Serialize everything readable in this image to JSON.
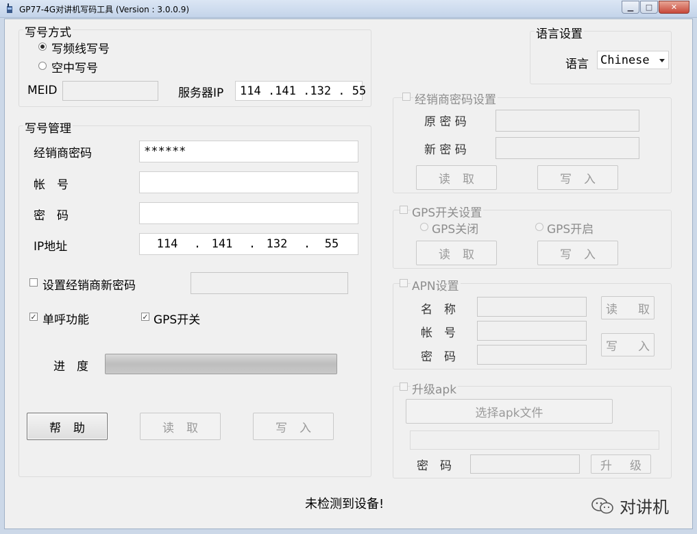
{
  "window": {
    "title": "GP77-4G对讲机写码工具 (Version : 3.0.0.9)",
    "minimize_glyph": "▁",
    "maximize_glyph": "□",
    "close_glyph": "✕"
  },
  "write_mode": {
    "title": "写号方式",
    "options": [
      {
        "label": "写频线写号",
        "selected": true
      },
      {
        "label": "空中写号",
        "selected": false
      }
    ],
    "meid_label": "MEID",
    "meid_value": "",
    "server_ip_label": "服务器IP",
    "server_ip_value": "114 .141 .132 . 55"
  },
  "management": {
    "title": "写号管理",
    "dealer_password_label": "经销商密码",
    "dealer_password_value": "******",
    "account_label": "帐　号",
    "account_value": "",
    "password_label": "密　码",
    "password_value": "",
    "ip_label": "IP地址",
    "ip_segments": [
      "114",
      "141",
      "132",
      "55"
    ],
    "ip_dot": ".",
    "set_new_password_label": "设置经销商新密码",
    "set_new_password_checked": false,
    "new_password_value": "",
    "single_call_label": "单呼功能",
    "single_call_checked": true,
    "gps_switch_label": "GPS开关",
    "gps_switch_checked": true,
    "progress_label": "进　度",
    "progress_fraction": 1.0,
    "help_button": "帮助",
    "read_button": "读取",
    "write_button": "写入"
  },
  "language": {
    "title": "语言设置",
    "label": "语言",
    "selected": "Chinese"
  },
  "dealer_password_settings": {
    "title": "经销商密码设置",
    "checked": false,
    "old_password_label": "原 密 码",
    "new_password_label": "新 密 码",
    "read_button": "读取",
    "write_button": "写入"
  },
  "gps_settings": {
    "title": "GPS开关设置",
    "checked": false,
    "off_label": "GPS关闭",
    "on_label": "GPS开启",
    "read_button": "读取",
    "write_button": "写入"
  },
  "apn_settings": {
    "title": "APN设置",
    "checked": false,
    "name_label": "名　称",
    "account_label": "帐　号",
    "password_label": "密　码",
    "read_button": "读取",
    "write_button": "写入"
  },
  "upgrade_apk": {
    "title": "升级apk",
    "checked": false,
    "select_file_button": "选择apk文件",
    "password_label": "密　码",
    "upgrade_button": "升级"
  },
  "status_text": "未检测到设备!",
  "watermark_text": "对讲机",
  "colors": {
    "window_bg": "#f0f0f0",
    "titlebar": "#c4d4ea",
    "close_button": "#c7483a",
    "disabled_text": "#8d8d8d"
  }
}
